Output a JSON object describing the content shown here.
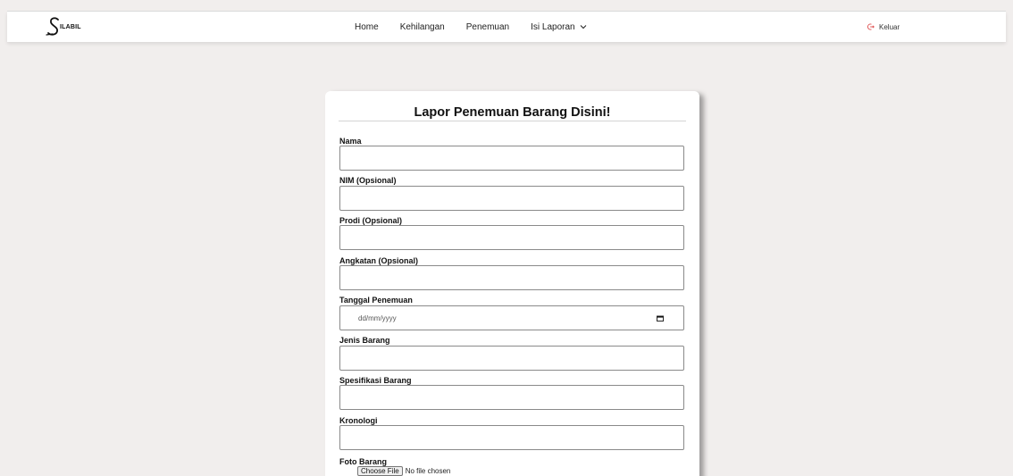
{
  "brand": {
    "logo_text": "ILABIL"
  },
  "nav": {
    "items": [
      {
        "label": "Home"
      },
      {
        "label": "Kehilangan"
      },
      {
        "label": "Penemuan"
      },
      {
        "label": "Isi Laporan"
      }
    ],
    "logout_label": "Keluar"
  },
  "form": {
    "title": "Lapor Penemuan Barang Disini!",
    "fields": [
      {
        "label": "Nama",
        "value": ""
      },
      {
        "label": "NIM (Opsional)",
        "value": ""
      },
      {
        "label": "Prodi (Opsional)",
        "value": ""
      },
      {
        "label": "Angkatan (Opsional)",
        "value": ""
      },
      {
        "label": "Tanggal Penemuan",
        "placeholder": "dd/mm/yyyy"
      },
      {
        "label": "Jenis Barang",
        "value": ""
      },
      {
        "label": "Spesifikasi Barang",
        "value": ""
      },
      {
        "label": "Kronologi",
        "value": ""
      }
    ],
    "photo": {
      "label": "Foto Barang",
      "button_label": "Choose File",
      "status": "No file chosen"
    }
  },
  "colors": {
    "page_bg": "#f1eeed",
    "card_bg": "#ffffff",
    "logout_icon": "#e05656"
  },
  "icons": {
    "dropdown": "chevron-down-icon",
    "logout": "logout-icon",
    "date": "calendar-icon"
  }
}
